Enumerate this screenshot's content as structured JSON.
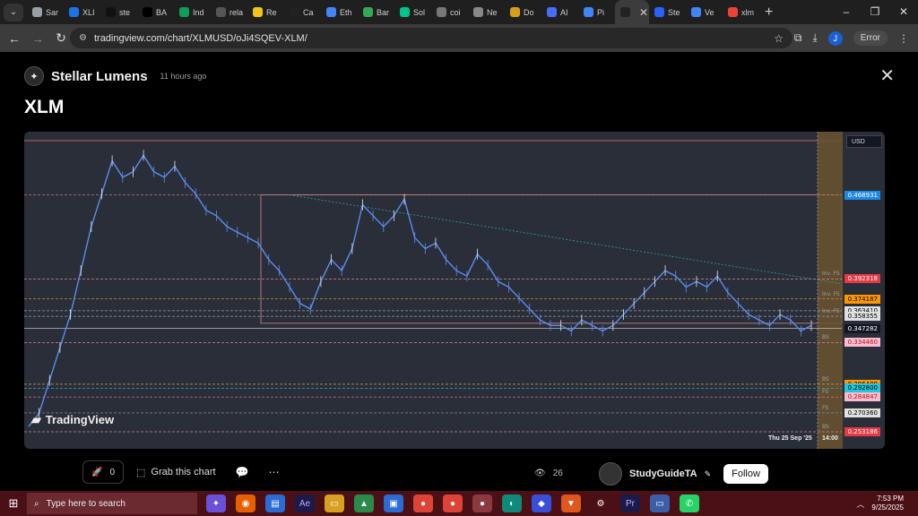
{
  "browser": {
    "tabs": [
      {
        "label": "Sar",
        "color": "#9aa0a6"
      },
      {
        "label": "XLI",
        "color": "#1a73e8"
      },
      {
        "label": "ste",
        "color": "#111111"
      },
      {
        "label": "BA",
        "color": "#000000"
      },
      {
        "label": "Ind",
        "color": "#0f9d58"
      },
      {
        "label": "rela",
        "color": "#555555"
      },
      {
        "label": "Re",
        "color": "#f0c419"
      },
      {
        "label": "Ca",
        "color": "#222222"
      },
      {
        "label": "Eth",
        "color": "#4285f4"
      },
      {
        "label": "Bar",
        "color": "#34a853"
      },
      {
        "label": "Sol",
        "color": "#00c389"
      },
      {
        "label": "coi",
        "color": "#777777"
      },
      {
        "label": "Ne",
        "color": "#888888"
      },
      {
        "label": "Do",
        "color": "#d4a017"
      },
      {
        "label": "AI",
        "color": "#4b6bfb"
      },
      {
        "label": "Pi",
        "color": "#4285f4"
      },
      {
        "label": "",
        "color": "#222222"
      },
      {
        "label": "Ste",
        "color": "#2962ff"
      },
      {
        "label": "Ve",
        "color": "#4285f4"
      },
      {
        "label": "xlm",
        "color": "#ea4335"
      }
    ],
    "url": "tradingview.com/chart/XLMUSD/oJi4SQEV-XLM/",
    "profile_initial": "J",
    "error_label": "Error"
  },
  "publication": {
    "author_line": "Stellar Lumens",
    "time_ago": "11 hours ago",
    "symbol": "XLM",
    "brand": "TradingView",
    "boosts": "0",
    "grab_label": "Grab this chart",
    "views": "26",
    "author": "StudyGuideTA",
    "follow_label": "Follow"
  },
  "chart_data": {
    "type": "line",
    "currency": "USD",
    "time_label": "Thu 25 Sep '25",
    "time_label2": "14:00",
    "ylim": [
      0.245,
      0.52
    ],
    "price_levels": [
      {
        "value": 0.468931,
        "label": "0.468931",
        "bg": "#1e88e5",
        "fg": "#ffffff",
        "tag": ""
      },
      {
        "value": 0.392318,
        "label": "0.392318",
        "bg": "#e53946",
        "fg": "#ffffff",
        "tag": "Inv. FS"
      },
      {
        "value": 0.374187,
        "label": "0.374187",
        "bg": "#ff9800",
        "fg": "#000000",
        "tag": "Inv. FS"
      },
      {
        "value": 0.36341,
        "label": "0.363410",
        "bg": "#e0e0e0",
        "fg": "#000000",
        "tag": ""
      },
      {
        "value": 0.358355,
        "label": "0.358355",
        "bg": "#e0e0e0",
        "fg": "#000000",
        "tag": "Inv. FS"
      },
      {
        "value": 0.347282,
        "label": "0.347282",
        "bg": "#131722",
        "fg": "#ffffff",
        "tag": ""
      },
      {
        "value": 0.33446,
        "label": "0.334460",
        "bg": "#f8bbd0",
        "fg": "#b71c1c",
        "tag": "BS"
      },
      {
        "value": 0.296489,
        "label": "0.296489",
        "bg": "#ff9800",
        "fg": "#000000",
        "tag": "BS"
      },
      {
        "value": 0.2928,
        "label": "0.292800",
        "bg": "#26c6da",
        "fg": "#000000",
        "tag": ""
      },
      {
        "value": 0.284847,
        "label": "0.284847",
        "bg": "#f8bbd0",
        "fg": "#b71c1c",
        "tag": "FS"
      },
      {
        "value": 0.27036,
        "label": "0.270360",
        "bg": "#e0e0e0",
        "fg": "#000000",
        "tag": "FS"
      },
      {
        "value": 0.253186,
        "label": "0.253186",
        "bg": "#e53946",
        "fg": "#ffffff",
        "tag": "BS"
      }
    ],
    "series": [
      {
        "values": [
          0.258,
          0.27,
          0.3,
          0.33,
          0.36,
          0.4,
          0.44,
          0.47,
          0.5,
          0.485,
          0.49,
          0.505,
          0.49,
          0.485,
          0.495,
          0.48,
          0.47,
          0.455,
          0.45,
          0.44,
          0.435,
          0.43,
          0.425,
          0.41,
          0.4,
          0.385,
          0.37,
          0.365,
          0.39,
          0.41,
          0.4,
          0.42,
          0.46,
          0.45,
          0.44,
          0.45,
          0.465,
          0.43,
          0.42,
          0.425,
          0.41,
          0.4,
          0.395,
          0.415,
          0.405,
          0.39,
          0.385,
          0.375,
          0.365,
          0.355,
          0.35,
          0.35,
          0.345,
          0.355,
          0.35,
          0.345,
          0.35,
          0.36,
          0.37,
          0.38,
          0.39,
          0.4,
          0.395,
          0.385,
          0.39,
          0.385,
          0.395,
          0.38,
          0.37,
          0.36,
          0.355,
          0.35,
          0.36,
          0.355,
          0.345,
          0.35
        ]
      }
    ]
  },
  "taskbar": {
    "search_placeholder": "Type here to search",
    "time": "7:53 PM",
    "date": "9/25/2025"
  }
}
